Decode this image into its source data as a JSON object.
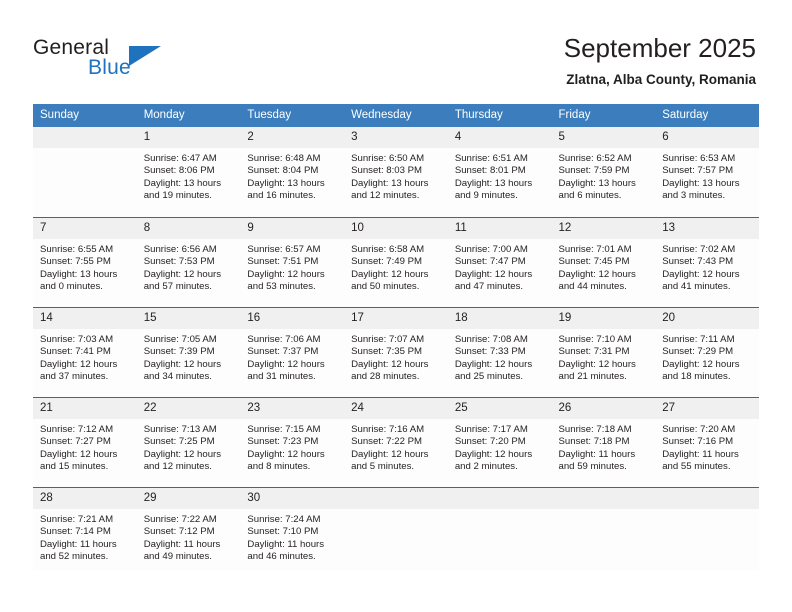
{
  "brand": {
    "name_primary": "General",
    "name_secondary": "Blue",
    "accent_color": "#1f72bd"
  },
  "header": {
    "title": "September 2025",
    "subtitle": "Zlatna, Alba County, Romania"
  },
  "theme": {
    "header_row_bg": "#3b7dbd",
    "daynum_bg": "#f0f0f0",
    "row_divider": "#2b6ca8",
    "text": "#231f20"
  },
  "weekday_headers": [
    "Sunday",
    "Monday",
    "Tuesday",
    "Wednesday",
    "Thursday",
    "Friday",
    "Saturday"
  ],
  "weeks": [
    [
      {
        "day": "",
        "sunrise": "",
        "sunset": "",
        "daylight1": "",
        "daylight2": ""
      },
      {
        "day": "1",
        "sunrise": "Sunrise: 6:47 AM",
        "sunset": "Sunset: 8:06 PM",
        "daylight1": "Daylight: 13 hours",
        "daylight2": "and 19 minutes."
      },
      {
        "day": "2",
        "sunrise": "Sunrise: 6:48 AM",
        "sunset": "Sunset: 8:04 PM",
        "daylight1": "Daylight: 13 hours",
        "daylight2": "and 16 minutes."
      },
      {
        "day": "3",
        "sunrise": "Sunrise: 6:50 AM",
        "sunset": "Sunset: 8:03 PM",
        "daylight1": "Daylight: 13 hours",
        "daylight2": "and 12 minutes."
      },
      {
        "day": "4",
        "sunrise": "Sunrise: 6:51 AM",
        "sunset": "Sunset: 8:01 PM",
        "daylight1": "Daylight: 13 hours",
        "daylight2": "and 9 minutes."
      },
      {
        "day": "5",
        "sunrise": "Sunrise: 6:52 AM",
        "sunset": "Sunset: 7:59 PM",
        "daylight1": "Daylight: 13 hours",
        "daylight2": "and 6 minutes."
      },
      {
        "day": "6",
        "sunrise": "Sunrise: 6:53 AM",
        "sunset": "Sunset: 7:57 PM",
        "daylight1": "Daylight: 13 hours",
        "daylight2": "and 3 minutes."
      }
    ],
    [
      {
        "day": "7",
        "sunrise": "Sunrise: 6:55 AM",
        "sunset": "Sunset: 7:55 PM",
        "daylight1": "Daylight: 13 hours",
        "daylight2": "and 0 minutes."
      },
      {
        "day": "8",
        "sunrise": "Sunrise: 6:56 AM",
        "sunset": "Sunset: 7:53 PM",
        "daylight1": "Daylight: 12 hours",
        "daylight2": "and 57 minutes."
      },
      {
        "day": "9",
        "sunrise": "Sunrise: 6:57 AM",
        "sunset": "Sunset: 7:51 PM",
        "daylight1": "Daylight: 12 hours",
        "daylight2": "and 53 minutes."
      },
      {
        "day": "10",
        "sunrise": "Sunrise: 6:58 AM",
        "sunset": "Sunset: 7:49 PM",
        "daylight1": "Daylight: 12 hours",
        "daylight2": "and 50 minutes."
      },
      {
        "day": "11",
        "sunrise": "Sunrise: 7:00 AM",
        "sunset": "Sunset: 7:47 PM",
        "daylight1": "Daylight: 12 hours",
        "daylight2": "and 47 minutes."
      },
      {
        "day": "12",
        "sunrise": "Sunrise: 7:01 AM",
        "sunset": "Sunset: 7:45 PM",
        "daylight1": "Daylight: 12 hours",
        "daylight2": "and 44 minutes."
      },
      {
        "day": "13",
        "sunrise": "Sunrise: 7:02 AM",
        "sunset": "Sunset: 7:43 PM",
        "daylight1": "Daylight: 12 hours",
        "daylight2": "and 41 minutes."
      }
    ],
    [
      {
        "day": "14",
        "sunrise": "Sunrise: 7:03 AM",
        "sunset": "Sunset: 7:41 PM",
        "daylight1": "Daylight: 12 hours",
        "daylight2": "and 37 minutes."
      },
      {
        "day": "15",
        "sunrise": "Sunrise: 7:05 AM",
        "sunset": "Sunset: 7:39 PM",
        "daylight1": "Daylight: 12 hours",
        "daylight2": "and 34 minutes."
      },
      {
        "day": "16",
        "sunrise": "Sunrise: 7:06 AM",
        "sunset": "Sunset: 7:37 PM",
        "daylight1": "Daylight: 12 hours",
        "daylight2": "and 31 minutes."
      },
      {
        "day": "17",
        "sunrise": "Sunrise: 7:07 AM",
        "sunset": "Sunset: 7:35 PM",
        "daylight1": "Daylight: 12 hours",
        "daylight2": "and 28 minutes."
      },
      {
        "day": "18",
        "sunrise": "Sunrise: 7:08 AM",
        "sunset": "Sunset: 7:33 PM",
        "daylight1": "Daylight: 12 hours",
        "daylight2": "and 25 minutes."
      },
      {
        "day": "19",
        "sunrise": "Sunrise: 7:10 AM",
        "sunset": "Sunset: 7:31 PM",
        "daylight1": "Daylight: 12 hours",
        "daylight2": "and 21 minutes."
      },
      {
        "day": "20",
        "sunrise": "Sunrise: 7:11 AM",
        "sunset": "Sunset: 7:29 PM",
        "daylight1": "Daylight: 12 hours",
        "daylight2": "and 18 minutes."
      }
    ],
    [
      {
        "day": "21",
        "sunrise": "Sunrise: 7:12 AM",
        "sunset": "Sunset: 7:27 PM",
        "daylight1": "Daylight: 12 hours",
        "daylight2": "and 15 minutes."
      },
      {
        "day": "22",
        "sunrise": "Sunrise: 7:13 AM",
        "sunset": "Sunset: 7:25 PM",
        "daylight1": "Daylight: 12 hours",
        "daylight2": "and 12 minutes."
      },
      {
        "day": "23",
        "sunrise": "Sunrise: 7:15 AM",
        "sunset": "Sunset: 7:23 PM",
        "daylight1": "Daylight: 12 hours",
        "daylight2": "and 8 minutes."
      },
      {
        "day": "24",
        "sunrise": "Sunrise: 7:16 AM",
        "sunset": "Sunset: 7:22 PM",
        "daylight1": "Daylight: 12 hours",
        "daylight2": "and 5 minutes."
      },
      {
        "day": "25",
        "sunrise": "Sunrise: 7:17 AM",
        "sunset": "Sunset: 7:20 PM",
        "daylight1": "Daylight: 12 hours",
        "daylight2": "and 2 minutes."
      },
      {
        "day": "26",
        "sunrise": "Sunrise: 7:18 AM",
        "sunset": "Sunset: 7:18 PM",
        "daylight1": "Daylight: 11 hours",
        "daylight2": "and 59 minutes."
      },
      {
        "day": "27",
        "sunrise": "Sunrise: 7:20 AM",
        "sunset": "Sunset: 7:16 PM",
        "daylight1": "Daylight: 11 hours",
        "daylight2": "and 55 minutes."
      }
    ],
    [
      {
        "day": "28",
        "sunrise": "Sunrise: 7:21 AM",
        "sunset": "Sunset: 7:14 PM",
        "daylight1": "Daylight: 11 hours",
        "daylight2": "and 52 minutes."
      },
      {
        "day": "29",
        "sunrise": "Sunrise: 7:22 AM",
        "sunset": "Sunset: 7:12 PM",
        "daylight1": "Daylight: 11 hours",
        "daylight2": "and 49 minutes."
      },
      {
        "day": "30",
        "sunrise": "Sunrise: 7:24 AM",
        "sunset": "Sunset: 7:10 PM",
        "daylight1": "Daylight: 11 hours",
        "daylight2": "and 46 minutes."
      },
      {
        "day": "",
        "sunrise": "",
        "sunset": "",
        "daylight1": "",
        "daylight2": ""
      },
      {
        "day": "",
        "sunrise": "",
        "sunset": "",
        "daylight1": "",
        "daylight2": ""
      },
      {
        "day": "",
        "sunrise": "",
        "sunset": "",
        "daylight1": "",
        "daylight2": ""
      },
      {
        "day": "",
        "sunrise": "",
        "sunset": "",
        "daylight1": "",
        "daylight2": ""
      }
    ]
  ]
}
